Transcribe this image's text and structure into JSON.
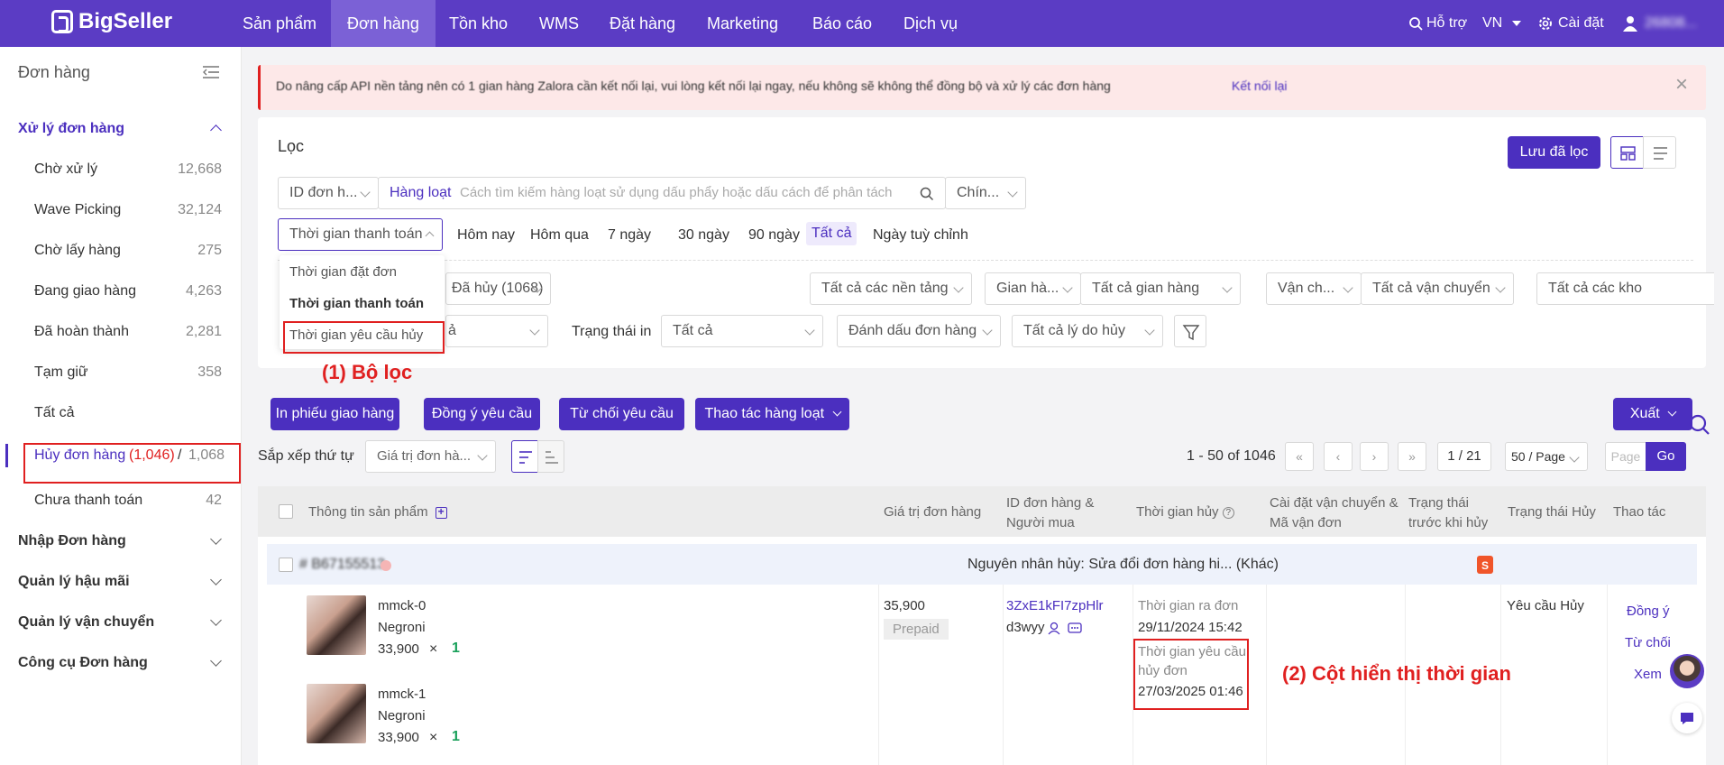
{
  "nav": {
    "logo": "BigSeller",
    "items": [
      "Sản phẩm",
      "Đơn hàng",
      "Tồn kho",
      "WMS",
      "Đặt hàng",
      "Marketing",
      "Báo cáo",
      "Dịch vụ"
    ],
    "help": "Hỗ trợ",
    "lang": "VN",
    "settings": "Cài đặt",
    "user": "26808..."
  },
  "sidebar": {
    "title": "Đơn hàng",
    "group1": "Xử lý đơn hàng",
    "items": [
      {
        "label": "Chờ xử lý",
        "count": "12,668"
      },
      {
        "label": "Wave Picking",
        "count": "32,124"
      },
      {
        "label": "Chờ lấy hàng",
        "count": "275"
      },
      {
        "label": "Đang giao hàng",
        "count": "4,263"
      },
      {
        "label": "Đã hoàn thành",
        "count": "2,281"
      },
      {
        "label": "Tạm giữ",
        "count": "358"
      },
      {
        "label": "Tất cả",
        "count": ""
      }
    ],
    "cancel": {
      "label": "Hủy đơn hàng",
      "count_red": "(1,046)",
      "sep": "/",
      "count_total": "1,068"
    },
    "unpaid": {
      "label": "Chưa thanh toán",
      "count": "42"
    },
    "groups": [
      "Nhập Đơn hàng",
      "Quản lý hậu mãi",
      "Quản lý vận chuyển",
      "Công cụ Đơn hàng"
    ]
  },
  "alert": {
    "text": "Do nâng cấp API nền tảng nên có 1 gian hàng Zalora cần kết nối lại, vui lòng kết nối lại ngay, nếu không sẽ không thể đồng bộ và xử lý các đơn hàng",
    "link": "Kết nối lại"
  },
  "filter": {
    "title": "Lọc",
    "save_btn": "Lưu đã lọc",
    "id_select": "ID đơn h...",
    "batch": "Hàng loạt",
    "search_placeholder": "Cách tìm kiếm hàng loạt sử dụng dấu phẩy hoặc dấu cách để phân tách",
    "exact": "Chín...",
    "time_select": "Thời gian thanh toán",
    "time_options": [
      "Hôm nay",
      "Hôm qua",
      "7 ngày",
      "30 ngày",
      "90 ngày",
      "Tất cả",
      "Ngày tuỳ chỉnh"
    ],
    "dropdown": [
      "Thời gian đặt đơn",
      "Thời gian thanh toán",
      "Thời gian yêu cầu hủy"
    ],
    "row2": [
      "Đã hủy (1068)",
      "Tất cả các nền tảng",
      "Gian hà...",
      "Tất cả gian hàng",
      "Vận ch...",
      "Tất cả vận chuyển",
      "Tất cả các kho"
    ],
    "row3_first": "ả",
    "print_status_label": "Trạng thái in",
    "row3": [
      "Tất cả",
      "Đánh dấu đơn hàng",
      "Tất cả lý do hủy"
    ],
    "annotation1": "(1) Bộ lọc"
  },
  "actions": {
    "buttons": [
      "In phiếu giao hàng",
      "Đồng ý yêu cầu",
      "Từ chối yêu cầu",
      "Thao tác hàng loạt"
    ],
    "export": "Xuất"
  },
  "sort": {
    "label": "Sắp xếp thứ tự",
    "value": "Giá trị đơn hà...",
    "range": "1 - 50 of 1046",
    "page": "1 / 21",
    "per_page": "50 / Page",
    "page_placeholder": "Page",
    "go": "Go"
  },
  "table": {
    "headers": [
      "Thông tin sản phẩm",
      "Giá trị đơn hàng",
      "ID đơn hàng & Người mua",
      "Thời gian hủy",
      "Cài đặt vận chuyển & Mã vận đơn",
      "Trạng thái trước khi hủy",
      "Trạng thái Hủy",
      "Thao tác"
    ],
    "order_no": "# B67155513",
    "cancel_reason": "Nguyên nhân hủy: Sửa đổi đơn hàng hi... (Khác)",
    "products": [
      {
        "name": "mmck-0",
        "variant": "Negroni",
        "price": "33,900",
        "x": "×",
        "qty": "1"
      },
      {
        "name": "mmck-1",
        "variant": "Negroni",
        "price": "33,900",
        "x": "×",
        "qty": "1"
      }
    ],
    "amount": "35,900",
    "payment": "Prepaid",
    "order_id": "3ZxE1kFI7zpHlr",
    "buyer": "d3wyy",
    "time1_label": "Thời gian ra đơn",
    "time1": "29/11/2024 15:42",
    "time2_label": "Thời gian yêu cầu hủy đơn",
    "time2": "27/03/2025 01:46",
    "status": "Yêu cầu Hủy",
    "ops": [
      "Đồng ý",
      "Từ chối",
      "Xem"
    ],
    "annotation2": "(2) Cột hiển thị thời gian"
  },
  "colors": {
    "brand": "#5b3cc4",
    "accent": "#4b2fbf",
    "annotation": "#e02020"
  }
}
